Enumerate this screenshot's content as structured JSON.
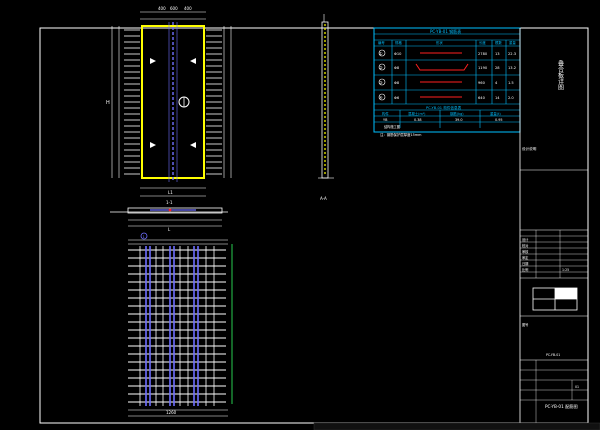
{
  "drawing": {
    "top_dims": [
      "400",
      "600",
      "400"
    ],
    "plan_left_dims": [
      "H"
    ],
    "plan_bottom_dims": [
      "L1",
      "L"
    ],
    "section_label": "1-1",
    "side_label": "A-A",
    "rebar_axis_label": "1",
    "bottom_dims": [
      "1260"
    ]
  },
  "rebar_table": {
    "title": "PC-YB-01 钢筋表",
    "header": [
      "编号",
      "规格",
      "形状",
      "长度",
      "根数",
      "重量"
    ],
    "rows": [
      {
        "no": "①",
        "spec": "Φ10",
        "length": "2780",
        "count": "13",
        "weight": "22.3"
      },
      {
        "no": "②",
        "spec": "Φ8",
        "length": "1190",
        "count": "28",
        "weight": "13.2"
      },
      {
        "no": "③",
        "spec": "Φ8",
        "length": "960",
        "count": "4",
        "weight": "1.5"
      },
      {
        "no": "④",
        "spec": "Φ6",
        "length": "640",
        "count": "14",
        "weight": "2.0"
      }
    ],
    "sub_title": "PC-YB-01 构件信息表",
    "sub_header": [
      "构件",
      "混凝土(m³)",
      "钢筋(kg)",
      "重量(t)"
    ],
    "sub_row": [
      "YB",
      "0.38",
      "39.0",
      "0.95"
    ],
    "note": "注：钢筋保护层厚度15mm"
  },
  "title_block": {
    "vertical_title": "叠合板详图",
    "label_small": "设计说明",
    "rows_label": [
      "设计",
      "校对",
      "审核",
      "审定",
      "日期",
      "比例"
    ],
    "stamp_label": "图号",
    "drawing_no": "PC-YB-01",
    "drawing_title": "PC-YB-01 配筋图",
    "sheet_no": "01",
    "project_label": "结构施工图",
    "scale": "1:25"
  },
  "colors": {
    "frame": "#ffffff",
    "dim": "#ffffff",
    "panel": "#ffff00",
    "table": "#00bfff",
    "rebar": "#6f6fff",
    "rebar_red": "#ff2020",
    "green": "#33ff66"
  }
}
